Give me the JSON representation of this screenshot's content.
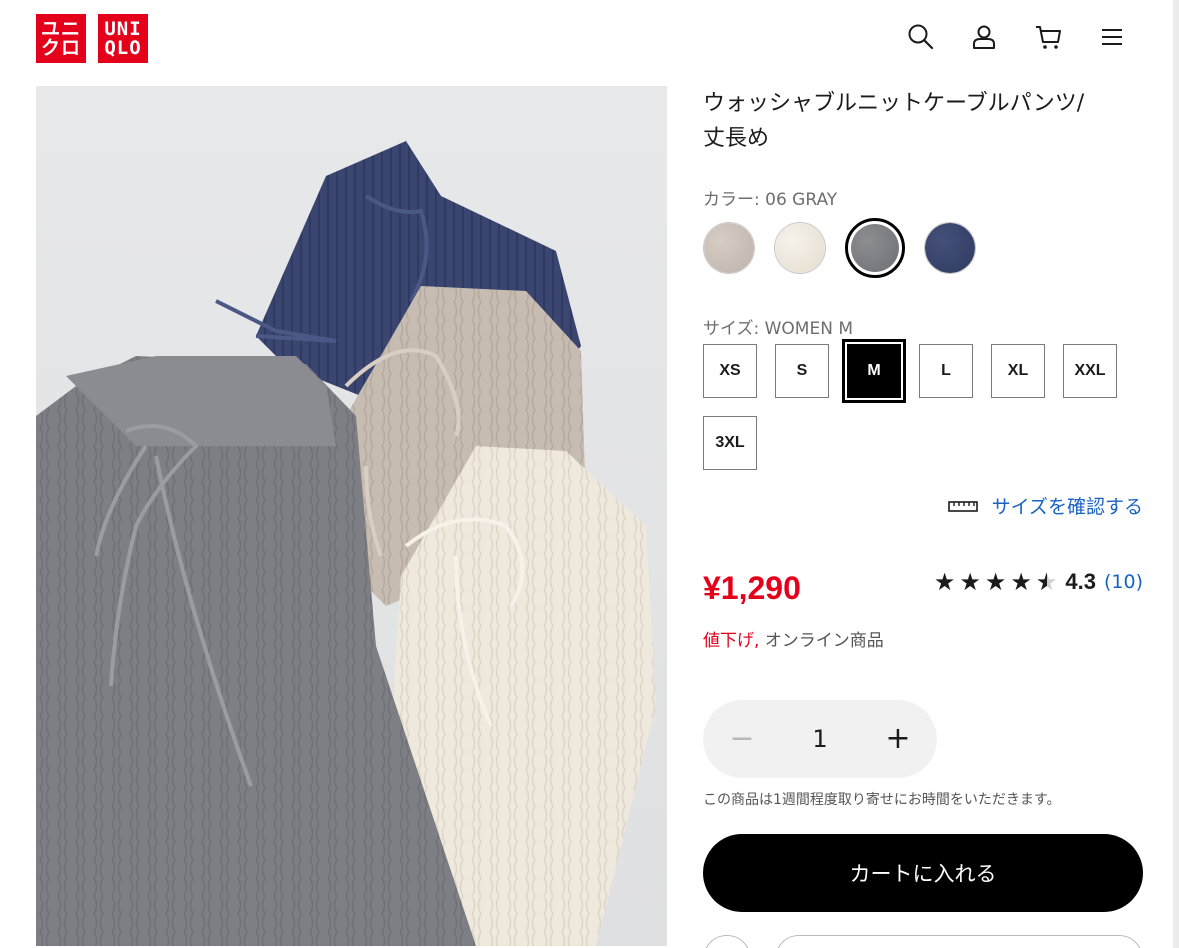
{
  "logo": {
    "box1": [
      "ユニ",
      "クロ"
    ],
    "box2": [
      "UNI",
      "QLO"
    ],
    "brand_color": "#e4001a"
  },
  "header_icons": [
    "search-icon",
    "account-icon",
    "cart-icon",
    "menu-icon"
  ],
  "product": {
    "title_line1": "ウォッシャブルニットケーブルパンツ/",
    "title_line2": "丈長め",
    "color_label": "カラー: 06 GRAY",
    "colors": [
      {
        "name": "beige",
        "hex": "#c9bfb7",
        "selected": false
      },
      {
        "name": "off-white",
        "hex": "#efe9df",
        "selected": false
      },
      {
        "name": "gray",
        "hex": "#7f8185",
        "selected": true
      },
      {
        "name": "navy",
        "hex": "#37426a",
        "selected": false
      }
    ],
    "size_label": "サイズ: WOMEN M",
    "sizes": [
      {
        "label": "XS",
        "selected": false
      },
      {
        "label": "S",
        "selected": false
      },
      {
        "label": "M",
        "selected": true
      },
      {
        "label": "L",
        "selected": false
      },
      {
        "label": "XL",
        "selected": false
      },
      {
        "label": "XXL",
        "selected": false
      },
      {
        "label": "3XL",
        "selected": false
      }
    ],
    "size_check_link": "サイズを確認する",
    "price": "¥1,290",
    "rating": {
      "value": "4.3",
      "count": "(10)",
      "stars": 4.3
    },
    "flag_sale": "値下げ,",
    "flag_online": "オンライン商品",
    "quantity": {
      "minus": "−",
      "value": "1",
      "plus": "+"
    },
    "delivery_note": "この商品は1週間程度取り寄せにお時間をいただきます。",
    "add_to_cart": "カートに入れる"
  },
  "colors": {
    "accent_red": "#e4001a",
    "link_blue": "#1a63c2"
  }
}
